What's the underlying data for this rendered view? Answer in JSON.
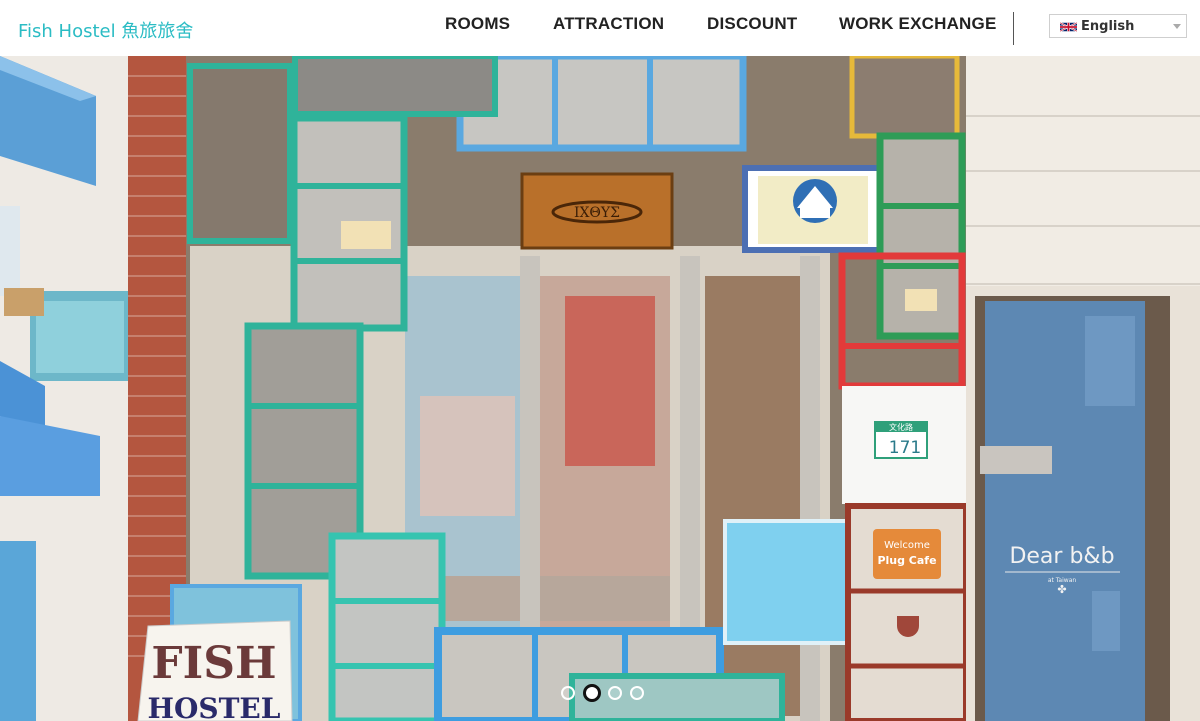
{
  "header": {
    "brand": "Fish Hostel 魚旅旅舍",
    "nav": [
      {
        "label": "ROOMS"
      },
      {
        "label": "ATTRACTION"
      },
      {
        "label": "DISCOUNT"
      },
      {
        "label": "WORK EXCHANGE"
      }
    ],
    "language": {
      "selected": "English",
      "flag_icon": "uk-flag-icon"
    }
  },
  "hero": {
    "sign_fish": "FISH",
    "sign_hostel": "HOSTEL",
    "wood_sign": "ΙΧΘΥΣ",
    "door_sign_title": "Dear b&b",
    "door_sign_sub": "at Taiwan",
    "address_road": "文化路",
    "address_number": "171",
    "cafe_sign_1": "Welcome",
    "cafe_sign_2": "Plug Cafe",
    "slides_total": 4,
    "slide_active": 2
  },
  "colors": {
    "brand": "#2bbcc4",
    "teal_frame": "#2fb39a",
    "blue_frame": "#5aa8e0",
    "brick": "#b4563f"
  }
}
